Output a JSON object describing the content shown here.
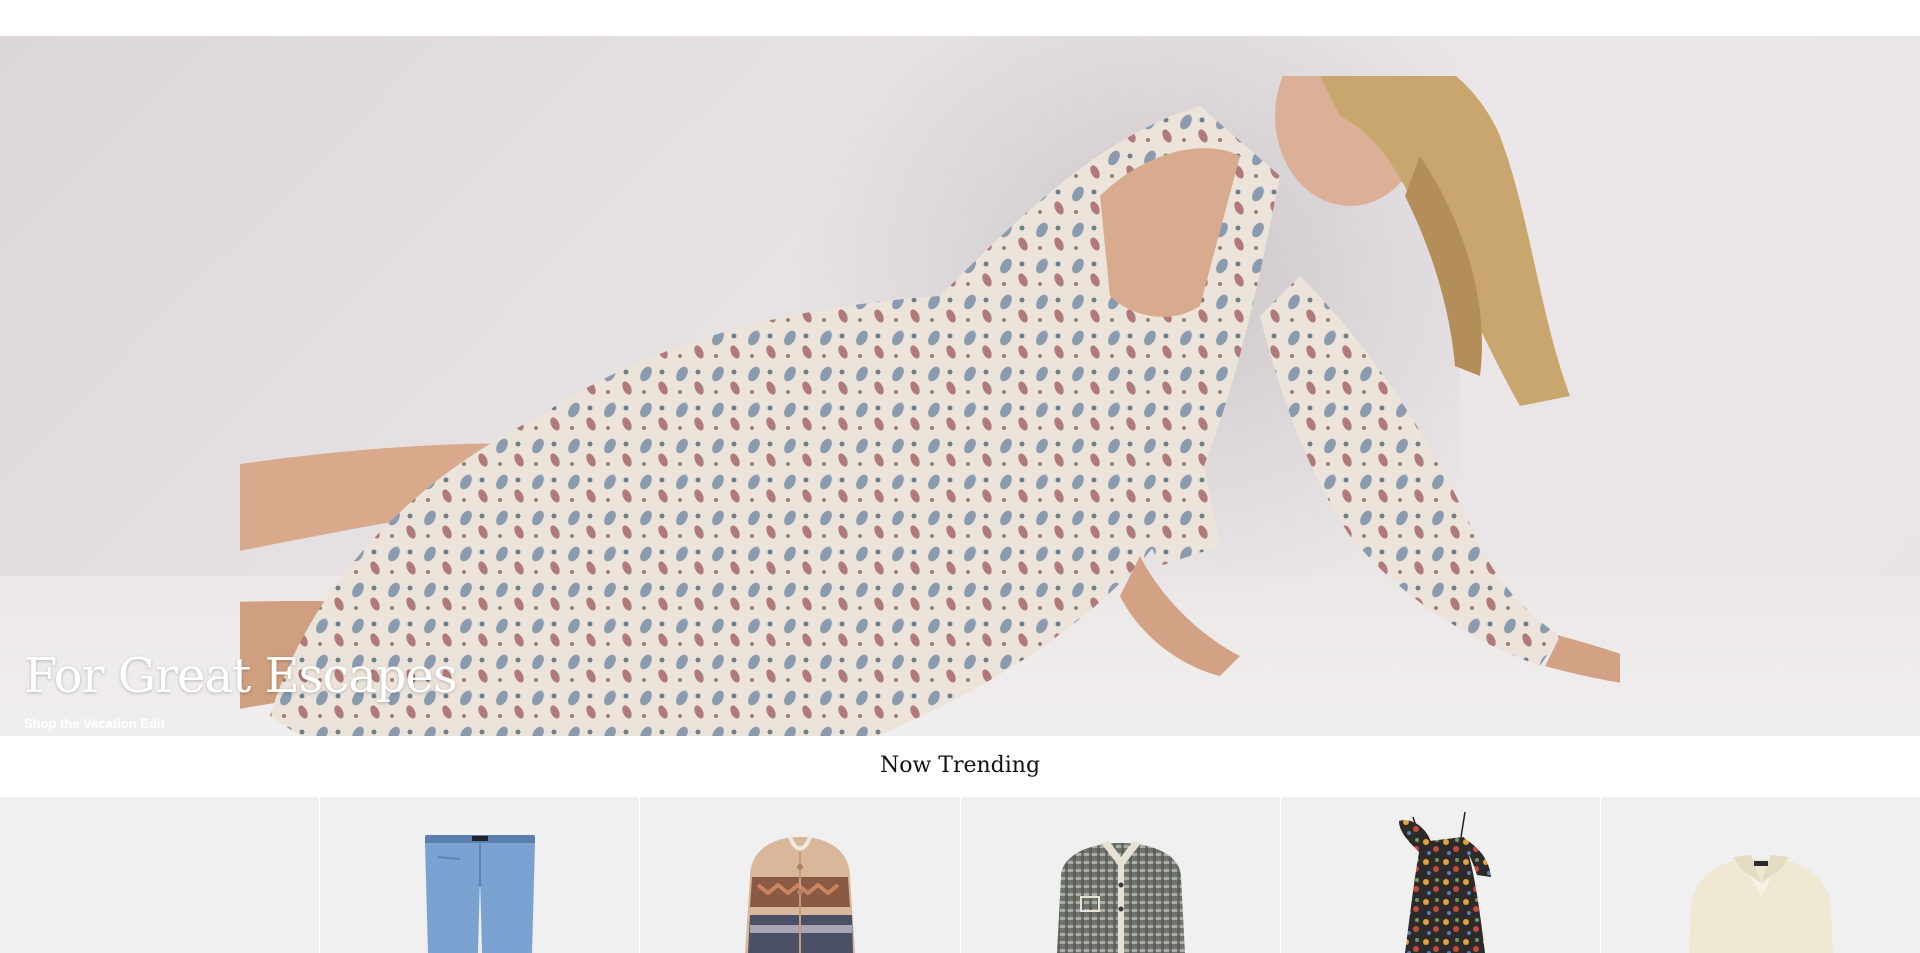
{
  "hero": {
    "title": "For Great Escapes",
    "cta_label": "Shop the Vacation Edit"
  },
  "trending": {
    "title": "Now Trending",
    "products": [
      {
        "name": "empty-slot"
      },
      {
        "name": "jeans"
      },
      {
        "name": "fair-isle-cardigan"
      },
      {
        "name": "plaid-shirt-jacket"
      },
      {
        "name": "floral-ruffle-dress"
      },
      {
        "name": "cream-polo-sweater"
      }
    ]
  },
  "colors": {
    "background": "#ffffff",
    "hero_text": "#ffffff",
    "product_tile_bg": "#f0f0f0",
    "heading": "#111111"
  }
}
